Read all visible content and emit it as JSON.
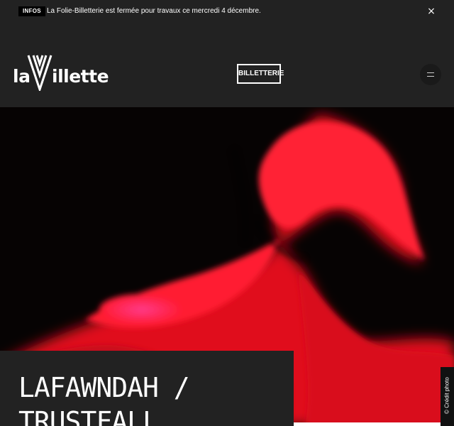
{
  "info_bar": {
    "badge": "INFOS",
    "message": "La Folie-Billetterie est fermée pour travaux ce mercredi 4 décembre.",
    "close_label": "×"
  },
  "header": {
    "logo": {
      "part1": "la",
      "part2": "illette"
    },
    "billetterie_label": "BILLETTERIE",
    "menu_icon": "hamburger-icon"
  },
  "hero": {
    "image": "red blurred figure on black background",
    "credit": "© Crédit photo"
  },
  "event": {
    "title": "LAFAWNDAH / TRUSTFALL"
  },
  "colors": {
    "background": "#222222",
    "accent_red": "#ff1a2e",
    "white": "#ffffff"
  }
}
